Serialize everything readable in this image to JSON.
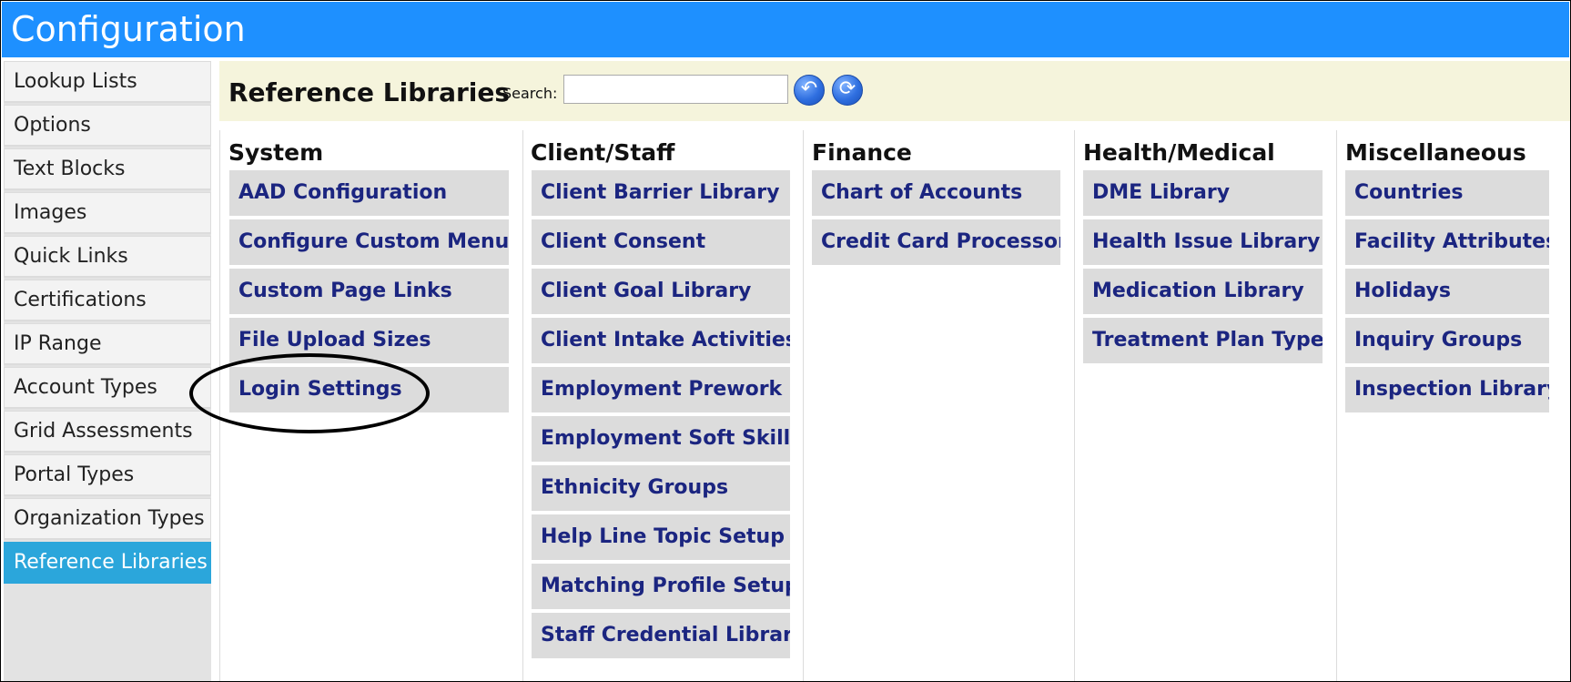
{
  "window": {
    "title": "Configuration"
  },
  "sidebar": {
    "items": [
      {
        "label": "Lookup Lists"
      },
      {
        "label": "Options"
      },
      {
        "label": "Text Blocks"
      },
      {
        "label": "Images"
      },
      {
        "label": "Quick Links"
      },
      {
        "label": "Certifications"
      },
      {
        "label": "IP Range"
      },
      {
        "label": "Account Types"
      },
      {
        "label": "Grid Assessments"
      },
      {
        "label": "Portal Types"
      },
      {
        "label": "Organization Types"
      },
      {
        "label": "Reference Libraries"
      }
    ],
    "active_item": "Reference Libraries"
  },
  "header": {
    "title": "Reference Libraries",
    "search_label": "Search:",
    "search_value": "",
    "back_icon": "undo-arrow-icon",
    "refresh_icon": "refresh-icon"
  },
  "columns": [
    {
      "title": "System",
      "items": [
        "AAD Configuration",
        "Configure Custom Menus",
        "Custom Page Links",
        "File Upload Sizes",
        "Login Settings"
      ]
    },
    {
      "title": "Client/Staff",
      "items": [
        "Client Barrier Library",
        "Client Consent",
        "Client Goal Library",
        "Client Intake Activities",
        "Employment Prework",
        "Employment Soft Skills",
        "Ethnicity Groups",
        "Help Line Topic Setup",
        "Matching Profile Setup",
        "Staff Credential Library"
      ]
    },
    {
      "title": "Finance",
      "items": [
        "Chart of Accounts",
        "Credit Card Processors"
      ]
    },
    {
      "title": "Health/Medical",
      "items": [
        "DME Library",
        "Health Issue Library",
        "Medication Library",
        "Treatment Plan Types"
      ]
    },
    {
      "title": "Miscellaneous",
      "items": [
        "Countries",
        "Facility Attributes",
        "Holidays",
        "Inquiry Groups",
        "Inspection Library"
      ]
    }
  ],
  "colors": {
    "titlebar": "#1e90ff",
    "sidebar_active": "#2ba6db",
    "header_bg": "#f5f4dc",
    "link_text": "#1b2580",
    "item_bg": "#dcdcdc"
  },
  "annotation": {
    "highlighted_item": "Login Settings",
    "shape": "hand-drawn-ellipse"
  }
}
